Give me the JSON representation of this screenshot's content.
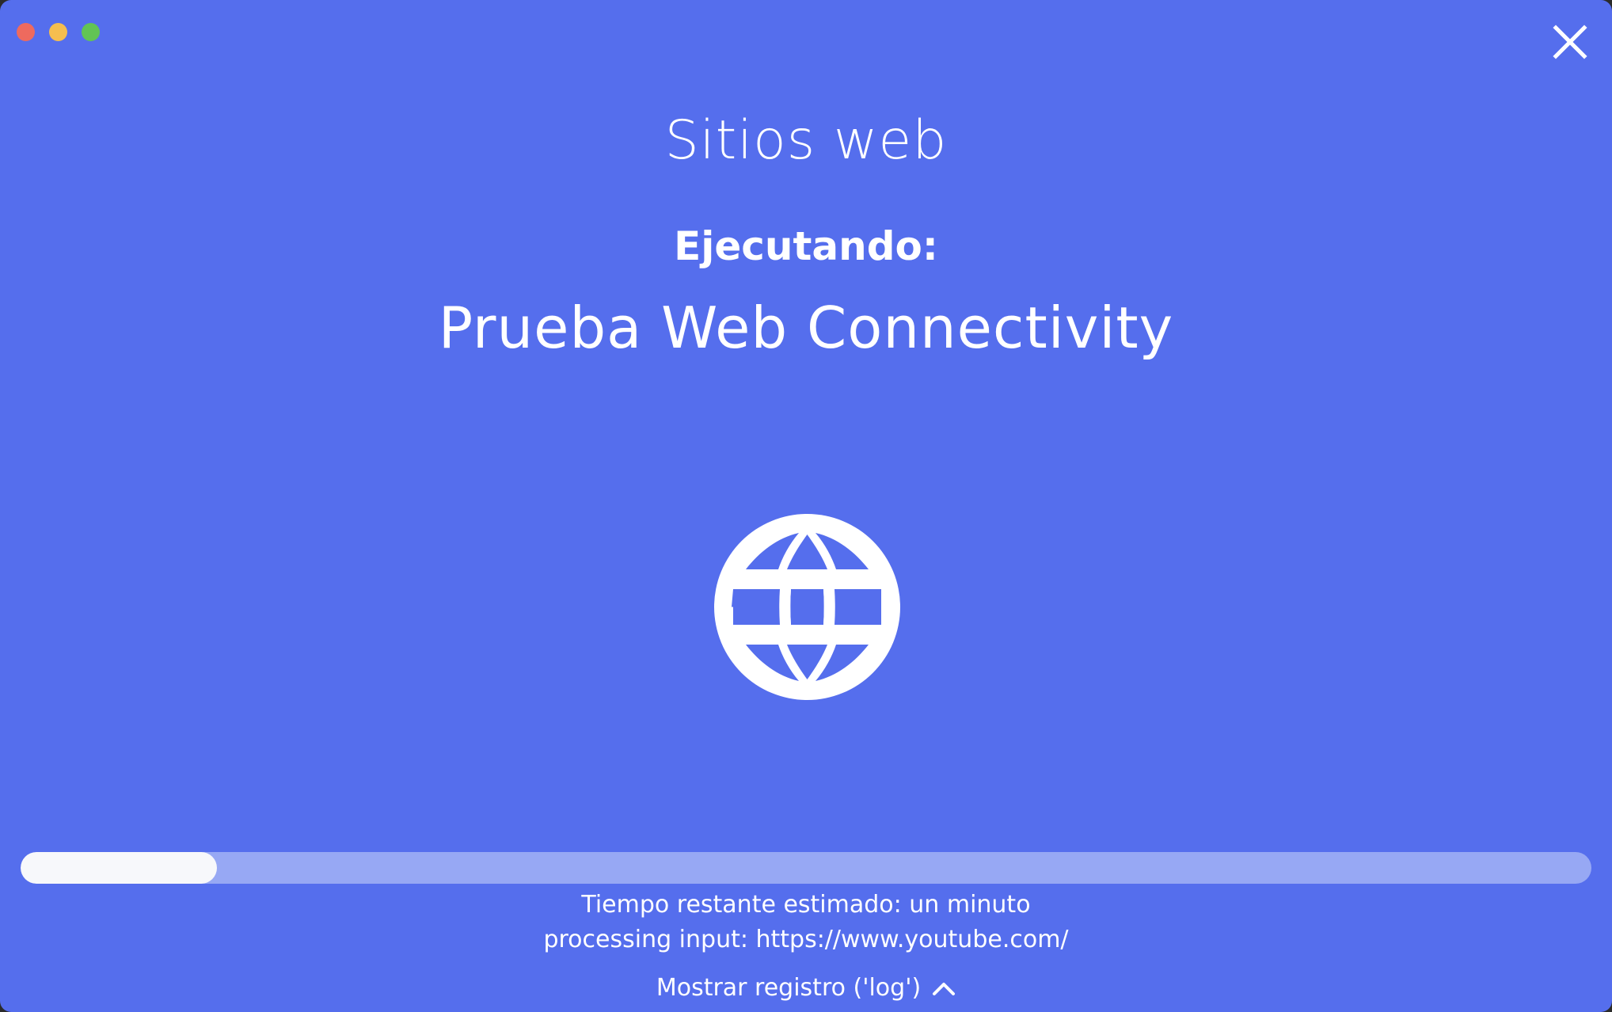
{
  "window_controls": {
    "close_color": "#ee6a5e",
    "minimize_color": "#f5be4f",
    "maximize_color": "#62c454"
  },
  "header": {
    "title": "Sitios web",
    "running_label": "Ejecutando:",
    "test_name": "Prueba Web Connectivity"
  },
  "icon": "globe-icon",
  "progress": {
    "value_percent": 12.5
  },
  "status": {
    "eta": "Tiempo restante estimado: un minuto",
    "processing": "processing input: https://www.youtube.com/"
  },
  "log_toggle": {
    "label": "Mostrar registro ('log')",
    "icon": "chevron-up-icon"
  },
  "colors": {
    "background": "#556eed",
    "progress_track": "#97a8f4",
    "progress_fill": "#f7f8fb",
    "text": "#ffffff"
  }
}
